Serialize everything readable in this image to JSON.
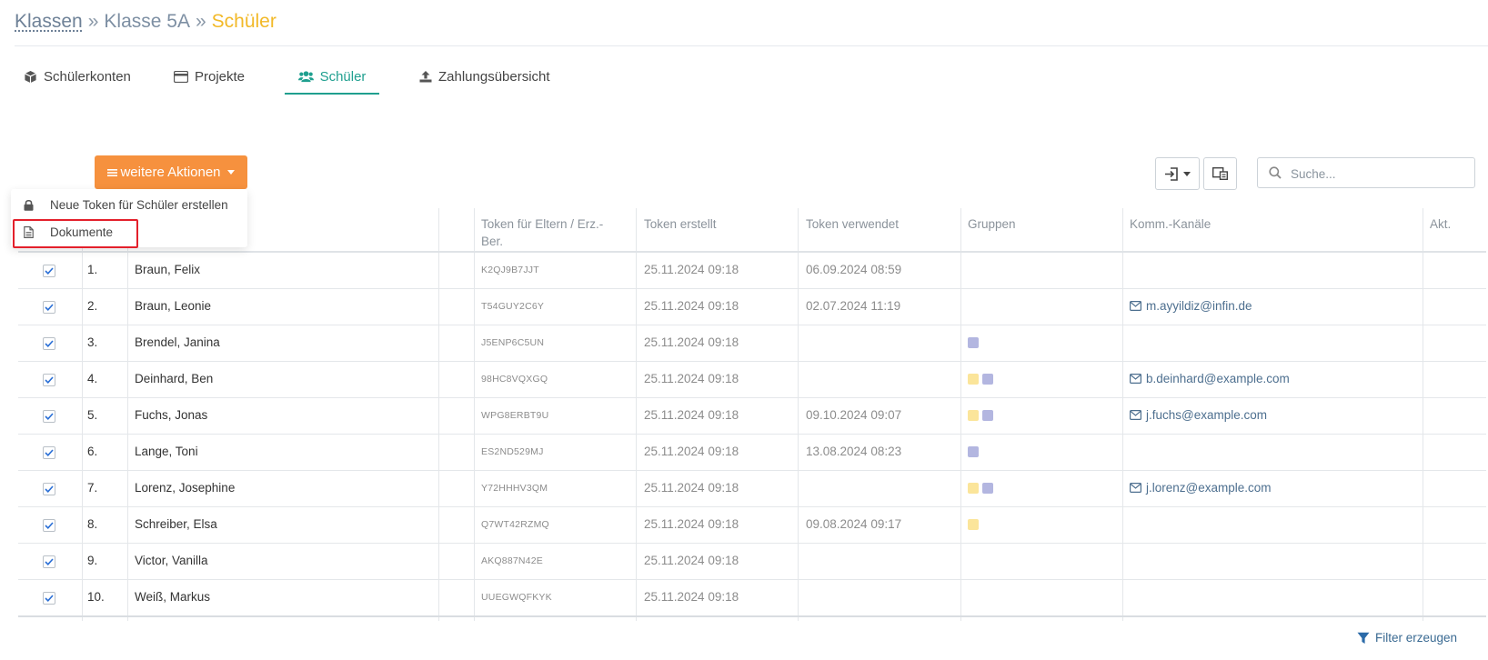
{
  "breadcrumb": {
    "root": "Klassen",
    "sep1": "»",
    "middle": "Klasse 5A",
    "sep2": "»",
    "current": "Schüler"
  },
  "tabs": [
    {
      "label": "Schülerkonten",
      "icon": "cube-icon"
    },
    {
      "label": "Projekte",
      "icon": "credit-card-icon"
    },
    {
      "label": "Schüler",
      "icon": "users-icon",
      "active": true
    },
    {
      "label": "Zahlungsübersicht",
      "icon": "upload-icon"
    }
  ],
  "actions": {
    "label": "weitere Aktionen",
    "icon": "bars-icon"
  },
  "dropdown": [
    {
      "label": "Neue Token für Schüler erstellen",
      "icon": "lock-icon"
    },
    {
      "label": "Dokumente",
      "icon": "document-icon"
    }
  ],
  "toolbar": {
    "export_icon": "sign-in-icon",
    "columns_icon": "columns-icon"
  },
  "search": {
    "placeholder": "Suche...",
    "value": ""
  },
  "table": {
    "headers": {
      "token_parents_line1": "Token für Eltern / Erz.-",
      "token_parents_line2": "Ber.",
      "token_created": "Token erstellt",
      "token_used": "Token verwendet",
      "groups": "Gruppen",
      "channels": "Komm.-Kanäle",
      "actions": "Akt."
    },
    "rows": [
      {
        "num": "1.",
        "name": "Braun, Felix",
        "token": "K2QJ9B7JJT",
        "created": "25.11.2024 09:18",
        "used": "06.09.2024 08:59",
        "groups": [],
        "email": ""
      },
      {
        "num": "2.",
        "name": "Braun, Leonie",
        "token": "T54GUY2C6Y",
        "created": "25.11.2024 09:18",
        "used": "02.07.2024 11:19",
        "groups": [],
        "email": "m.ayyildiz@infin.de"
      },
      {
        "num": "3.",
        "name": "Brendel, Janina",
        "token": "J5ENP6C5UN",
        "created": "25.11.2024 09:18",
        "used": "",
        "groups": [
          "purple"
        ],
        "email": ""
      },
      {
        "num": "4.",
        "name": "Deinhard, Ben",
        "token": "98HC8VQXGQ",
        "created": "25.11.2024 09:18",
        "used": "",
        "groups": [
          "yellow",
          "purple"
        ],
        "email": "b.deinhard@example.com"
      },
      {
        "num": "5.",
        "name": "Fuchs, Jonas",
        "token": "WPG8ERBT9U",
        "created": "25.11.2024 09:18",
        "used": "09.10.2024 09:07",
        "groups": [
          "yellow",
          "purple"
        ],
        "email": "j.fuchs@example.com"
      },
      {
        "num": "6.",
        "name": "Lange, Toni",
        "token": "ES2ND529MJ",
        "created": "25.11.2024 09:18",
        "used": "13.08.2024 08:23",
        "groups": [
          "purple"
        ],
        "email": ""
      },
      {
        "num": "7.",
        "name": "Lorenz, Josephine",
        "token": "Y72HHHV3QM",
        "created": "25.11.2024 09:18",
        "used": "",
        "groups": [
          "yellow",
          "purple"
        ],
        "email": "j.lorenz@example.com"
      },
      {
        "num": "8.",
        "name": "Schreiber, Elsa",
        "token": "Q7WT42RZMQ",
        "created": "25.11.2024 09:18",
        "used": "09.08.2024 09:17",
        "groups": [
          "yellow"
        ],
        "email": ""
      },
      {
        "num": "9.",
        "name": "Victor, Vanilla",
        "token": "AKQ887N42E",
        "created": "25.11.2024 09:18",
        "used": "",
        "groups": [],
        "email": ""
      },
      {
        "num": "10.",
        "name": "Weiß, Markus",
        "token": "UUEGWQFKYK",
        "created": "25.11.2024 09:18",
        "used": "",
        "groups": [],
        "email": ""
      }
    ]
  },
  "colors": {
    "accent_orange": "#f6913e",
    "active_teal": "#1f9f8f",
    "group_yellow": "#fbe59a",
    "group_purple": "#b3b6e0",
    "breadcrumb_current": "#f2b928",
    "highlight_red": "#e3202b"
  },
  "filter": {
    "label": "Filter erzeugen",
    "icon": "filter-icon"
  }
}
